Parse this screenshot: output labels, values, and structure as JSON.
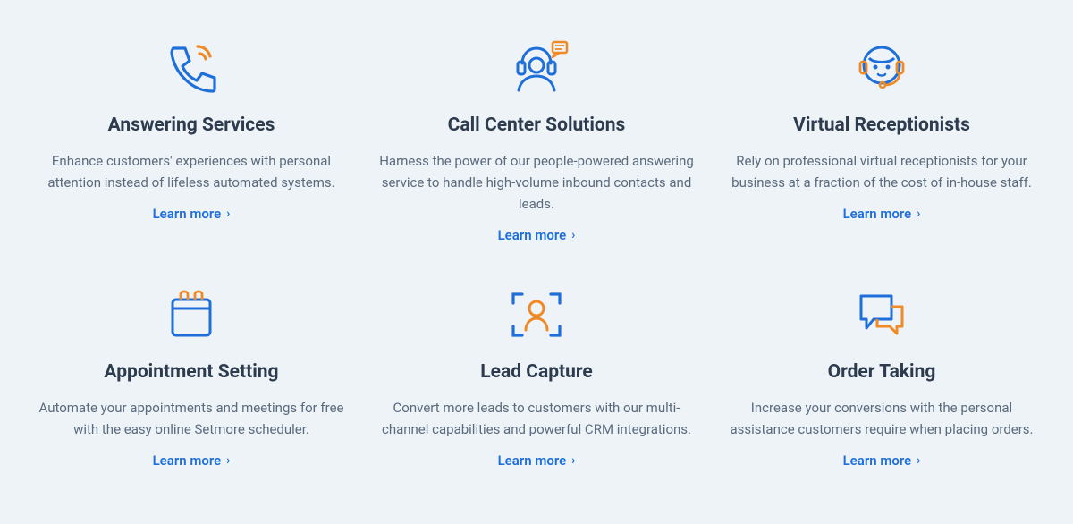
{
  "cards": [
    {
      "title": "Answering Services",
      "description": "Enhance customers' experiences with personal attention instead of lifeless automated systems.",
      "link_label": "Learn more"
    },
    {
      "title": "Call Center Solutions",
      "description": "Harness the power of our people-powered answering service to handle high-volume inbound contacts and leads.",
      "link_label": "Learn more"
    },
    {
      "title": "Virtual Receptionists",
      "description": "Rely on professional virtual receptionists for your business at a fraction of the cost of in-house staff.",
      "link_label": "Learn more"
    },
    {
      "title": "Appointment Setting",
      "description": "Automate your appointments and meetings for free with the easy online Setmore scheduler.",
      "link_label": "Learn more"
    },
    {
      "title": "Lead Capture",
      "description": "Convert more leads to customers with our multi-channel capabilities and powerful CRM integrations.",
      "link_label": "Learn more"
    },
    {
      "title": "Order Taking",
      "description": "Increase your conversions with the personal assistance customers require when placing orders.",
      "link_label": "Learn more"
    }
  ],
  "colors": {
    "blue": "#1e6fd9",
    "orange": "#f08a24"
  }
}
